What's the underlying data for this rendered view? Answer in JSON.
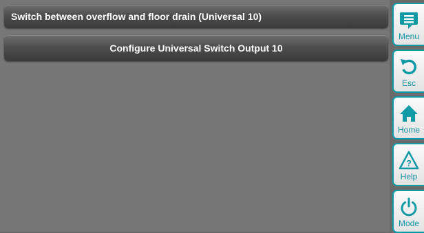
{
  "header": {
    "title": "Switch between overflow and floor drain (Universal 10)"
  },
  "main": {
    "config_button_label": "Configure Universal Switch Output 10"
  },
  "sidebar": {
    "items": [
      {
        "label": "Menu",
        "icon": "menu-icon"
      },
      {
        "label": "Esc",
        "icon": "back-arrow-icon"
      },
      {
        "label": "Home",
        "icon": "home-icon"
      },
      {
        "label": "Help",
        "icon": "help-icon"
      },
      {
        "label": "Mode",
        "icon": "power-icon"
      }
    ]
  },
  "colors": {
    "accent": "#0f9aa6",
    "background": "#777777",
    "bar": "#4e4e4e"
  }
}
